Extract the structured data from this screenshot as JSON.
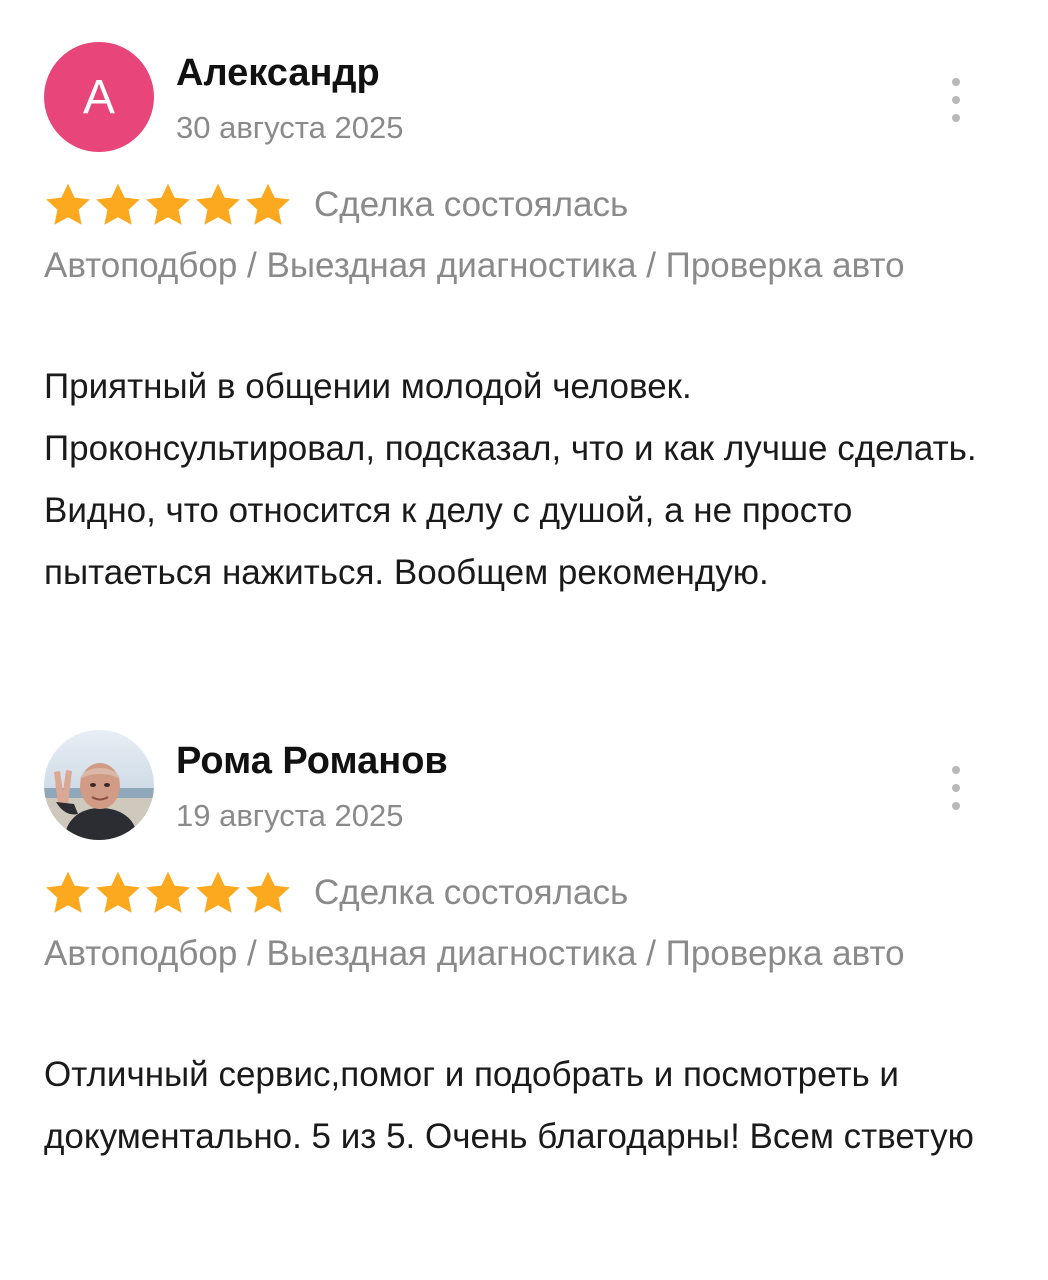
{
  "reviews": [
    {
      "author": "Александр",
      "avatar": {
        "type": "letter",
        "letter": "А",
        "color": "#e8457a"
      },
      "date": "30 августа 2025",
      "rating": 5,
      "status": "Сделка состоялась",
      "category": "Автоподбор / Выездная диагностика / Проверка авто",
      "text": "Приятный в общении молодой человек. Проконсультировал, подсказал, что и как лучше сделать. Видно, что относится к делу с душой, а не просто пытаеться нажиться. Вообщем рекомендую."
    },
    {
      "author": "Рома Романов",
      "avatar": {
        "type": "photo"
      },
      "date": "19 августа 2025",
      "rating": 5,
      "status": "Сделка состоялась",
      "category": "Автоподбор / Выездная диагностика / Проверка авто",
      "text": "Отличный сервис,помог и подобрать и посмотреть и документально. 5 из 5. Очень благодарны! Всем стветую"
    }
  ],
  "colors": {
    "star": "#fca91f",
    "secondary_text": "#8a8a8a",
    "menu_dots": "#b8b8b8"
  },
  "icons": {
    "star": "star-icon",
    "menu": "more-vertical-icon"
  }
}
